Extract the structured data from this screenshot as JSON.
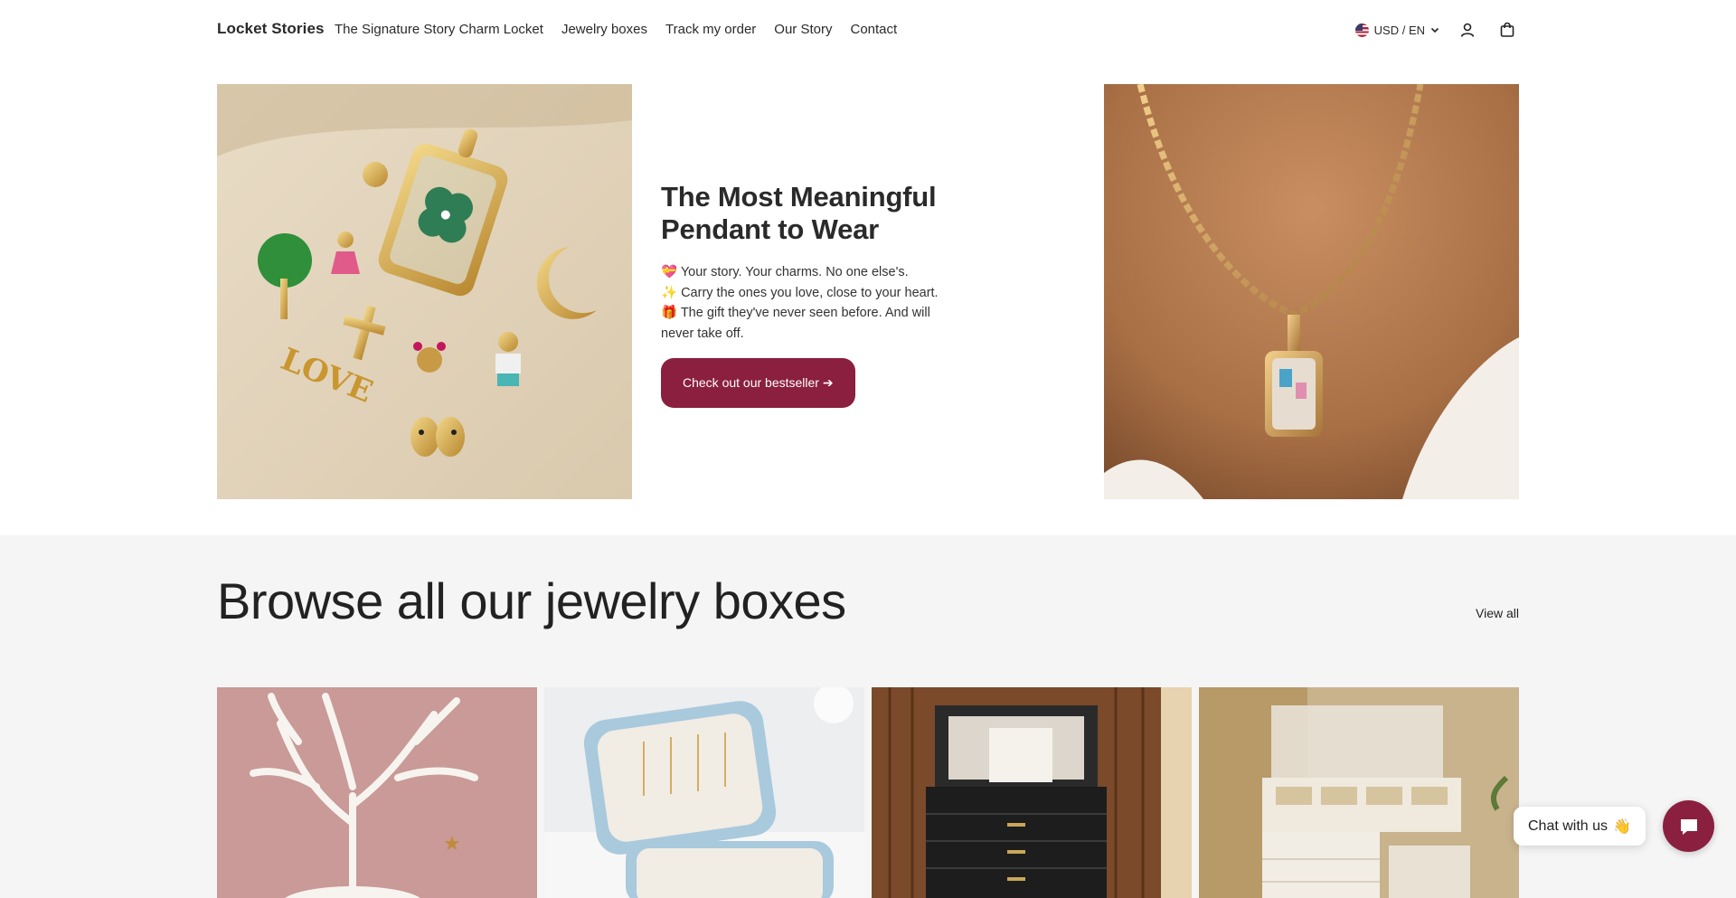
{
  "header": {
    "logo": "Locket Stories",
    "nav": [
      {
        "label": "The Signature Story Charm Locket"
      },
      {
        "label": "Jewelry boxes"
      },
      {
        "label": "Track my order"
      },
      {
        "label": "Our Story"
      },
      {
        "label": "Contact"
      }
    ],
    "currency_label": "USD / EN",
    "icons": {
      "account": "account-icon",
      "cart": "bag-icon",
      "currency": "chevron-down-icon"
    }
  },
  "hero": {
    "title_line1": "The Most Meaningful",
    "title_line2": "Pendant to Wear",
    "lines": [
      "💝 Your story. Your charms. No one else's.",
      "✨ Carry the ones you love, close to your heart.",
      "🎁 The gift they've never seen before. And will never take off."
    ],
    "cta": "Check out our bestseller ➔"
  },
  "browse": {
    "title": "Browse all our jewelry boxes",
    "view_all": "View all"
  },
  "chat": {
    "bubble_text": "Chat with us",
    "bubble_emoji": "👋"
  },
  "colors": {
    "accent": "#8a1f3f",
    "section_bg": "#f5f5f5"
  }
}
